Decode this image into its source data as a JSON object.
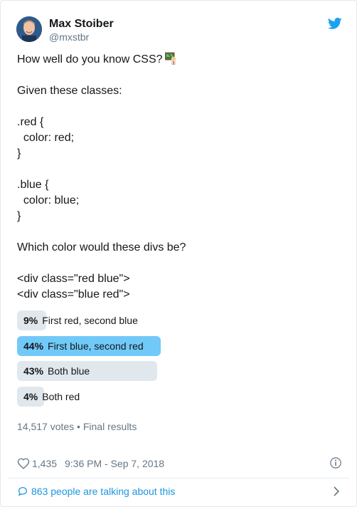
{
  "author": {
    "name": "Max Stoiber",
    "handle": "@mxstbr"
  },
  "tweet": {
    "lines": [
      "How well do you know CSS?",
      "",
      "Given these classes:",
      "",
      ".red {",
      "  color: red;",
      "}",
      "",
      ".blue {",
      "  color: blue;",
      "}",
      "",
      "Which color would these divs be?",
      "",
      "<div class=\"red blue\">",
      "<div class=\"blue red\">"
    ],
    "emoji_icon": "person-at-blackboard-emoji"
  },
  "poll": {
    "options": [
      {
        "percent": "9%",
        "percent_value": 9,
        "label": "First red, second blue",
        "winner": false
      },
      {
        "percent": "44%",
        "percent_value": 44,
        "label": "First blue, second red",
        "winner": true
      },
      {
        "percent": "43%",
        "percent_value": 43,
        "label": "Both blue",
        "winner": false
      },
      {
        "percent": "4%",
        "percent_value": 4,
        "label": "Both red",
        "winner": false
      }
    ],
    "summary": "14,517 votes • Final results",
    "colors": {
      "winner": "#71c9f8",
      "other": "#e1e8ed"
    }
  },
  "meta": {
    "likes": "1,435",
    "timestamp": "9:36 PM - Sep 7, 2018"
  },
  "footer": {
    "talking": "863 people are talking about this"
  },
  "colors": {
    "link": "#1b95e0",
    "muted": "#657786",
    "twitter_blue": "#1da1f2"
  }
}
